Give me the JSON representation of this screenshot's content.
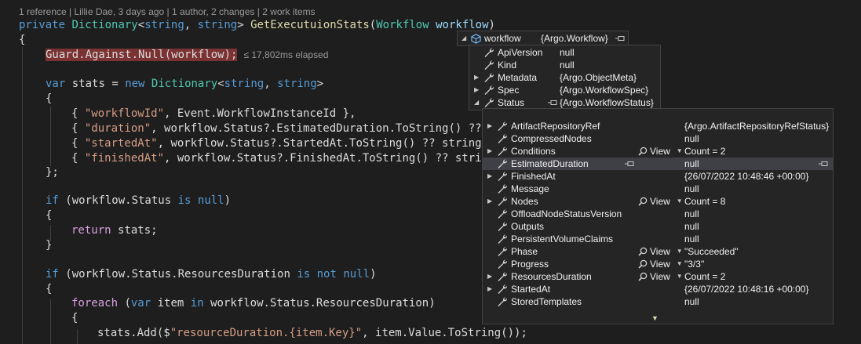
{
  "codelens": "1 reference | Lillie Dae, 3 days ago | 1 author, 2 changes | 2 work items",
  "code": {
    "method_kw": "private",
    "method_type": "Dictionary",
    "method_generic_open": "<",
    "str_kw": "string",
    "comma": ", ",
    "method_generic_close": ">",
    "method_name": "GetExecutuionStats",
    "param_type": "Workflow",
    "param_name": "workflow",
    "open_brace": "{",
    "close_brace": "}",
    "guard_text": "Guard.Against.Null(workflow);",
    "elapsed": "≤ 17,802ms elapsed",
    "var_kw": "var",
    "stats": "stats",
    "new_kw": "new",
    "entry1_key": "\"workflowId\"",
    "entry1_val": "Event.WorkflowInstanceId },",
    "entry2_key": "\"duration\"",
    "entry2_rest": "workflow.Status?.EstimatedDuration.ToString() ??",
    "entry3_key": "\"startedAt\"",
    "entry3_rest": "workflow.Status?.StartedAt.ToString() ?? string.",
    "entry4_key": "\"finishedAt\"",
    "entry4_rest": "workflow.Status?.FinishedAt.ToString() ?? strin",
    "close_init": "};",
    "if_kw": "if",
    "if1_cond": "workflow.Status",
    "is_kw": "is",
    "null_kw": "null",
    "return_kw": "return",
    "return_val": "stats;",
    "if2_cond": "workflow.Status.ResourcesDuration",
    "not_kw": "not",
    "foreach_kw": "foreach",
    "item": "item",
    "in_kw": "in",
    "foreach_src": "workflow.Status.ResourcesDuration",
    "add_call": "stats.Add($",
    "add_str": "\"resourceDuration.{item.Key}\"",
    "add_rest": ", item.Value.ToString());"
  },
  "tip_root": {
    "name": "workflow",
    "value": "{Argo.Workflow}"
  },
  "tip_level1": [
    {
      "name": "ApiVersion",
      "value": "null",
      "expandable": false
    },
    {
      "name": "Kind",
      "value": "null",
      "expandable": false
    },
    {
      "name": "Metadata",
      "value": "{Argo.ObjectMeta}",
      "expandable": true
    },
    {
      "name": "Spec",
      "value": "{Argo.WorkflowSpec}",
      "expandable": true
    },
    {
      "name": "Status",
      "value": "{Argo.WorkflowStatus}",
      "expandable": true
    }
  ],
  "tip_level2": [
    {
      "name": "ArtifactRepositoryRef",
      "value": "{Argo.ArtifactRepositoryRefStatus}",
      "expandable": true,
      "view": false
    },
    {
      "name": "CompressedNodes",
      "value": "null",
      "expandable": false,
      "view": false
    },
    {
      "name": "Conditions",
      "value": "Count = 2",
      "expandable": true,
      "view": true
    },
    {
      "name": "EstimatedDuration",
      "value": "null",
      "expandable": false,
      "view": false
    },
    {
      "name": "FinishedAt",
      "value": "{26/07/2022 10:48:46 +00:00}",
      "expandable": true,
      "view": false
    },
    {
      "name": "Message",
      "value": "null",
      "expandable": false,
      "view": false
    },
    {
      "name": "Nodes",
      "value": "Count = 8",
      "expandable": true,
      "view": true
    },
    {
      "name": "OffloadNodeStatusVersion",
      "value": "null",
      "expandable": false,
      "view": false
    },
    {
      "name": "Outputs",
      "value": "null",
      "expandable": false,
      "view": false
    },
    {
      "name": "PersistentVolumeClaims",
      "value": "null",
      "expandable": false,
      "view": false
    },
    {
      "name": "Phase",
      "value": "\"Succeeded\"",
      "expandable": false,
      "view": true
    },
    {
      "name": "Progress",
      "value": "\"3/3\"",
      "expandable": false,
      "view": true
    },
    {
      "name": "ResourcesDuration",
      "value": "Count = 2",
      "expandable": true,
      "view": true
    },
    {
      "name": "StartedAt",
      "value": "{26/07/2022 10:48:16 +00:00}",
      "expandable": true,
      "view": false
    },
    {
      "name": "StoredTemplates",
      "value": "null",
      "expandable": false,
      "view": false
    }
  ],
  "view_label": "View",
  "colors": {
    "keyword": "#569cd6",
    "type": "#4ec9b0",
    "method": "#dcdcaa",
    "string": "#d69d85",
    "breakpoint_highlight": "#7a3232"
  }
}
